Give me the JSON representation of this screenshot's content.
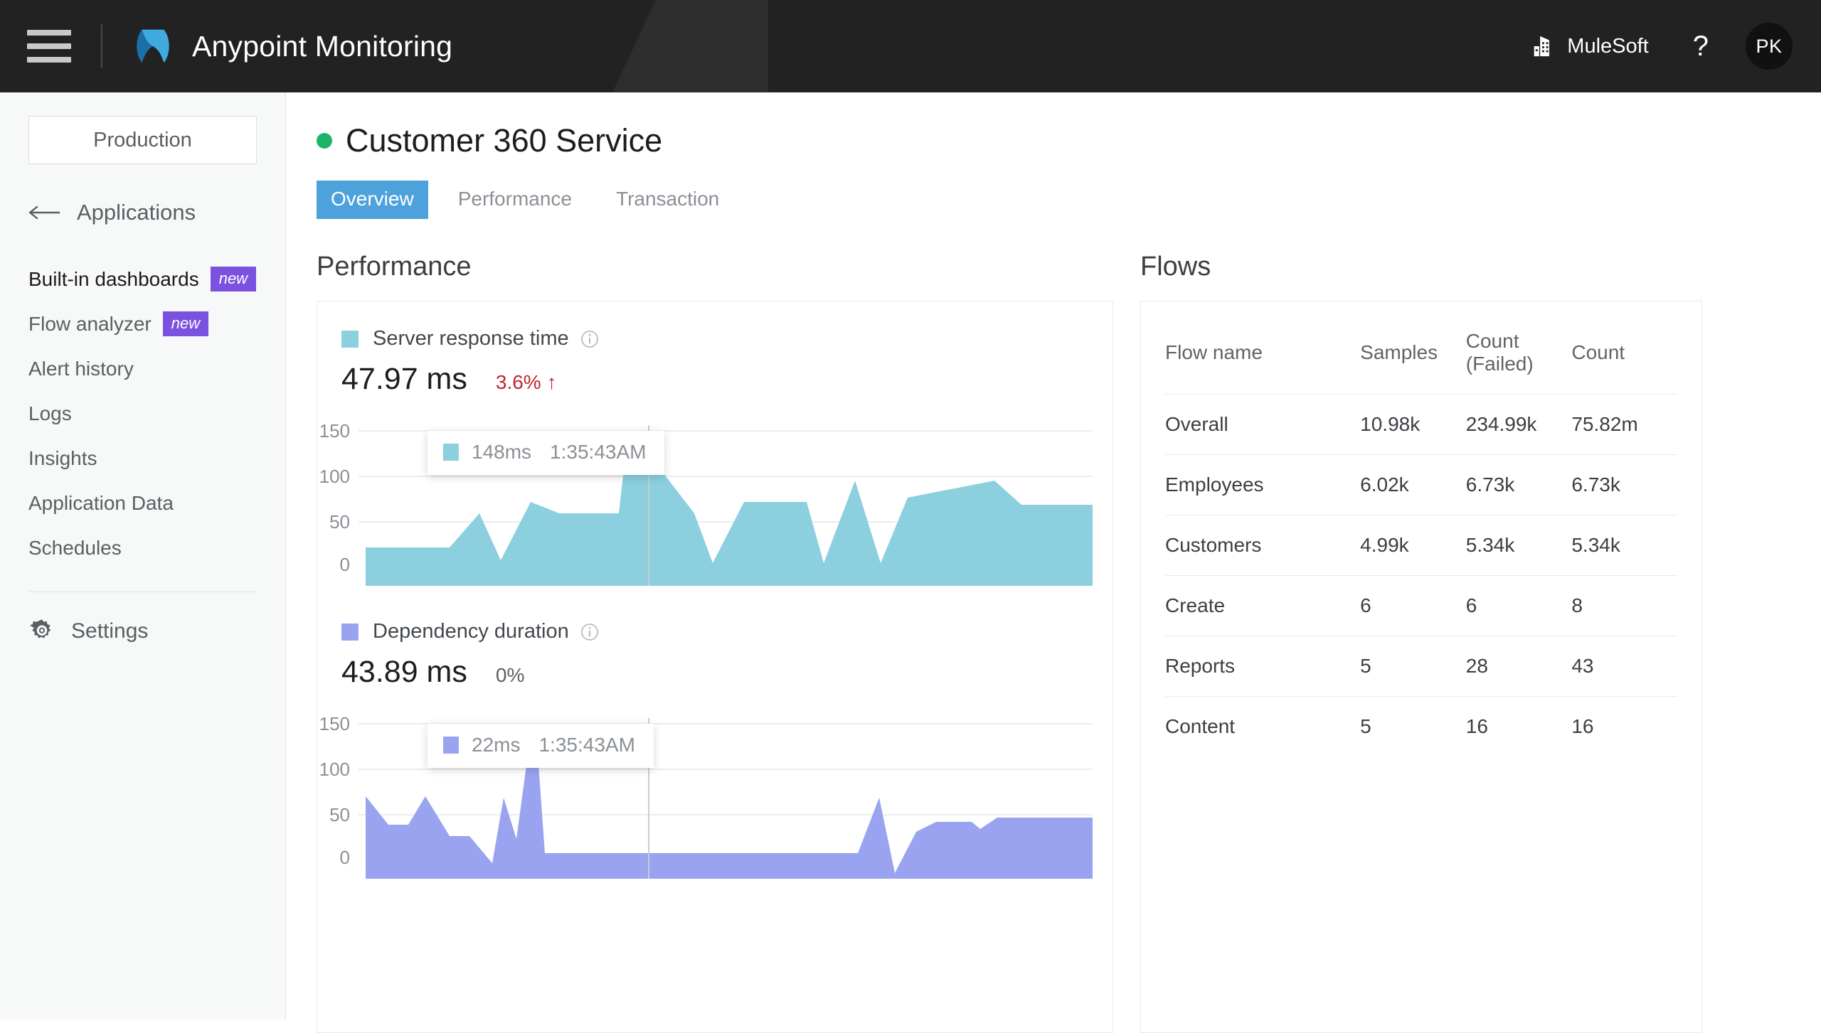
{
  "topbar": {
    "menu_icon": "hamburger-icon",
    "logo_icon": "anypoint-logo-icon",
    "title": "Anypoint Monitoring",
    "org_icon": "building-icon",
    "org_name": "MuleSoft",
    "help_icon": "?",
    "avatar_initials": "PK"
  },
  "sidebar": {
    "environment": "Production",
    "back_icon": "left-arrow-icon",
    "back_label": "Applications",
    "items": [
      {
        "label": "Built-in dashboards",
        "badge": "new",
        "active": true
      },
      {
        "label": "Flow analyzer",
        "badge": "new",
        "active": false
      },
      {
        "label": "Alert history",
        "badge": "",
        "active": false
      },
      {
        "label": "Logs",
        "badge": "",
        "active": false
      },
      {
        "label": "Insights",
        "badge": "",
        "active": false
      },
      {
        "label": "Application Data",
        "badge": "",
        "active": false
      },
      {
        "label": "Schedules",
        "badge": "",
        "active": false
      }
    ],
    "settings_icon": "gear-icon",
    "settings_label": "Settings"
  },
  "page": {
    "status": "healthy",
    "title": "Customer 360 Service",
    "tabs": [
      {
        "label": "Overview",
        "active": true
      },
      {
        "label": "Performance",
        "active": false
      },
      {
        "label": "Transaction",
        "active": false
      }
    ]
  },
  "performance": {
    "section_title": "Performance",
    "metrics": [
      {
        "name": "Server response time",
        "info_icon": "info-circle-icon",
        "value": "47.97 ms",
        "delta": "3.6% ↑",
        "delta_direction": "up",
        "color": "#8ccfdf",
        "tooltip": {
          "value": "148ms",
          "time": "1:35:43AM"
        }
      },
      {
        "name": "Dependency duration",
        "info_icon": "info-circle-icon",
        "value": "43.89 ms",
        "delta": "0%",
        "delta_direction": "flat",
        "color": "#9aa3f0",
        "tooltip": {
          "value": "22ms",
          "time": "1:35:43AM"
        }
      }
    ]
  },
  "flows": {
    "section_title": "Flows",
    "columns": [
      "Flow name",
      "Samples",
      "Count (Failed)",
      "Count"
    ],
    "rows": [
      {
        "name": "Overall",
        "samples": "10.98k",
        "failed": "234.99k",
        "count": "75.82m"
      },
      {
        "name": "Employees",
        "samples": "6.02k",
        "failed": "6.73k",
        "count": "6.73k"
      },
      {
        "name": "Customers",
        "samples": "4.99k",
        "failed": "5.34k",
        "count": "5.34k"
      },
      {
        "name": "Create",
        "samples": "6",
        "failed": "6",
        "count": "8"
      },
      {
        "name": "Reports",
        "samples": "5",
        "failed": "28",
        "count": "43"
      },
      {
        "name": "Content",
        "samples": "5",
        "failed": "16",
        "count": "16"
      }
    ]
  },
  "chart_data": [
    {
      "type": "area",
      "title": "Server response time",
      "unit": "ms",
      "color": "#8ccfdf",
      "ylabel": "",
      "xlabel": "",
      "ylim": [
        0,
        170
      ],
      "yticks": [
        0,
        50,
        100,
        150
      ],
      "grid": true,
      "legend": "none",
      "annotation": {
        "label": "148ms",
        "time": "1:35:43AM",
        "x_index": 12
      },
      "x": [
        0,
        1,
        2,
        3,
        4,
        5,
        6,
        7,
        8,
        9,
        10,
        11,
        12,
        13,
        14,
        15,
        16,
        17,
        18,
        19,
        20,
        21,
        22,
        23,
        24,
        25,
        26
      ],
      "values": [
        22,
        22,
        22,
        22,
        62,
        10,
        78,
        62,
        62,
        62,
        128,
        148,
        118,
        62,
        5,
        75,
        75,
        75,
        5,
        95,
        5,
        80,
        85,
        90,
        95,
        100,
        72
      ]
    },
    {
      "type": "area",
      "title": "Dependency duration",
      "unit": "ms",
      "color": "#9aa3f0",
      "ylabel": "",
      "xlabel": "",
      "ylim": [
        0,
        170
      ],
      "yticks": [
        0,
        50,
        100,
        150
      ],
      "grid": true,
      "legend": "none",
      "annotation": {
        "label": "22ms",
        "time": "1:35:43AM",
        "x_index": 12
      },
      "x": [
        0,
        1,
        2,
        3,
        4,
        5,
        6,
        7,
        8,
        9,
        10,
        11,
        12,
        13,
        14,
        15,
        16,
        17,
        18,
        19,
        20,
        21,
        22,
        23,
        24,
        25,
        26
      ],
      "values": [
        0,
        80,
        45,
        80,
        20,
        20,
        -8,
        78,
        30,
        128,
        0,
        0,
        0,
        0,
        0,
        0,
        0,
        0,
        0,
        78,
        -12,
        50,
        62,
        62,
        55,
        62,
        62
      ]
    }
  ],
  "colors": {
    "accent_blue": "#4da2db",
    "badge_purple": "#7b52e0",
    "status_green": "#1eb36b",
    "delta_red": "#c0272d",
    "topbar": "#222222",
    "sidebar": "#f7f8f8"
  }
}
